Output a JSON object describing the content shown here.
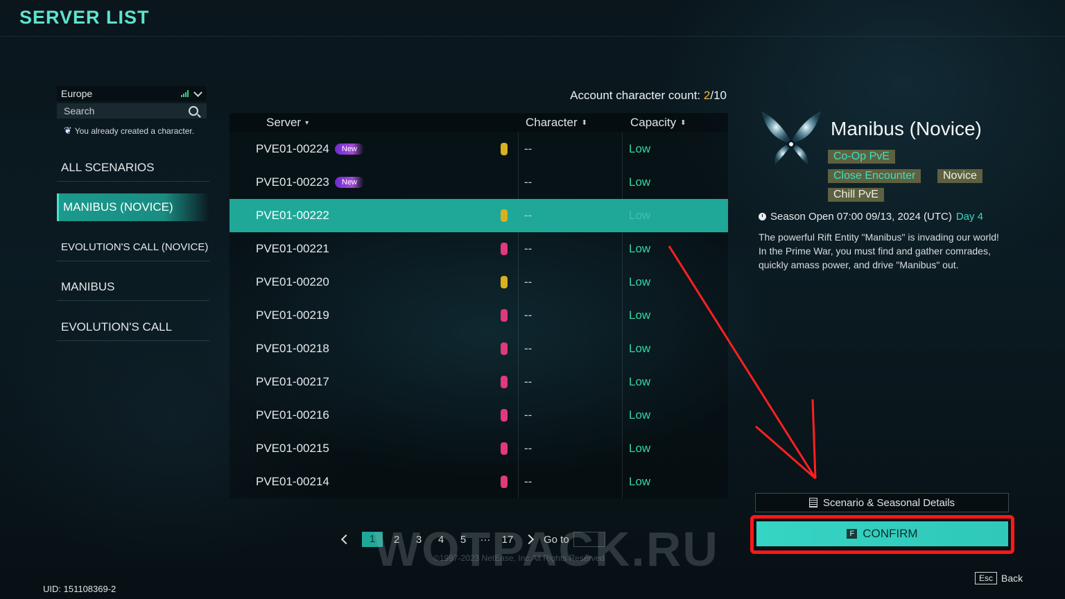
{
  "header": {
    "title": "SERVER LIST"
  },
  "sidebar": {
    "region": "Europe",
    "search_placeholder": "Search",
    "created_note": "You already created a character.",
    "categories": [
      {
        "label": "ALL SCENARIOS"
      },
      {
        "label": "MANIBUS (NOVICE)"
      },
      {
        "label": "EVOLUTION'S CALL (NOVICE)"
      },
      {
        "label": "MANIBUS"
      },
      {
        "label": "EVOLUTION'S CALL"
      }
    ],
    "active_category": "MANIBUS (NOVICE)"
  },
  "account": {
    "label": "Account character count:",
    "current": "2",
    "max": "/10"
  },
  "table": {
    "columns": {
      "server": "Server",
      "character": "Character",
      "capacity": "Capacity"
    },
    "rows": [
      {
        "name": "PVE01-00224",
        "badge": "New",
        "load": "yellow",
        "character": "--",
        "capacity": "Low"
      },
      {
        "name": "PVE01-00223",
        "badge": "New",
        "load": "",
        "character": "--",
        "capacity": "Low"
      },
      {
        "name": "PVE01-00222",
        "badge": "",
        "load": "yellow",
        "character": "--",
        "capacity": "Low",
        "selected": true
      },
      {
        "name": "PVE01-00221",
        "badge": "",
        "load": "pink",
        "character": "--",
        "capacity": "Low"
      },
      {
        "name": "PVE01-00220",
        "badge": "",
        "load": "yellow",
        "character": "--",
        "capacity": "Low"
      },
      {
        "name": "PVE01-00219",
        "badge": "",
        "load": "pink",
        "character": "--",
        "capacity": "Low"
      },
      {
        "name": "PVE01-00218",
        "badge": "",
        "load": "pink",
        "character": "--",
        "capacity": "Low"
      },
      {
        "name": "PVE01-00217",
        "badge": "",
        "load": "pink",
        "character": "--",
        "capacity": "Low"
      },
      {
        "name": "PVE01-00216",
        "badge": "",
        "load": "pink",
        "character": "--",
        "capacity": "Low"
      },
      {
        "name": "PVE01-00215",
        "badge": "",
        "load": "pink",
        "character": "--",
        "capacity": "Low"
      },
      {
        "name": "PVE01-00214",
        "badge": "",
        "load": "pink",
        "character": "--",
        "capacity": "Low"
      }
    ]
  },
  "pagination": {
    "pages": [
      "1",
      "2",
      "3",
      "4",
      "5",
      "···",
      "17"
    ],
    "current": "1",
    "goto_label": "Go to"
  },
  "detail": {
    "title": "Manibus (Novice)",
    "tags": [
      "Co-Op PvE",
      "Close Encounter",
      "Novice",
      "Chill PvE"
    ],
    "season_label": "Season Open 07:00 09/13, 2024 (UTC)",
    "season_day": "Day 4",
    "description": "The powerful Rift Entity \"Manibus\" is invading our world! In the Prime War, you must find and gather comrades, quickly amass power, and drive \"Manibus\" out.",
    "details_button": "Scenario & Seasonal Details",
    "confirm_key": "F",
    "confirm_label": "CONFIRM"
  },
  "footer": {
    "back_key": "Esc",
    "back_label": "Back",
    "uid": "UID: 151108369-2",
    "copyright": "©1997-2023 NetEase, Inc.All Rights Reserved",
    "watermark": "WOTPACK.RU"
  },
  "colors": {
    "accent": "#1fa898",
    "title": "#5fe3cf",
    "capacity_low": "#37d6a0",
    "confirm_highlight": "#ff1818"
  }
}
